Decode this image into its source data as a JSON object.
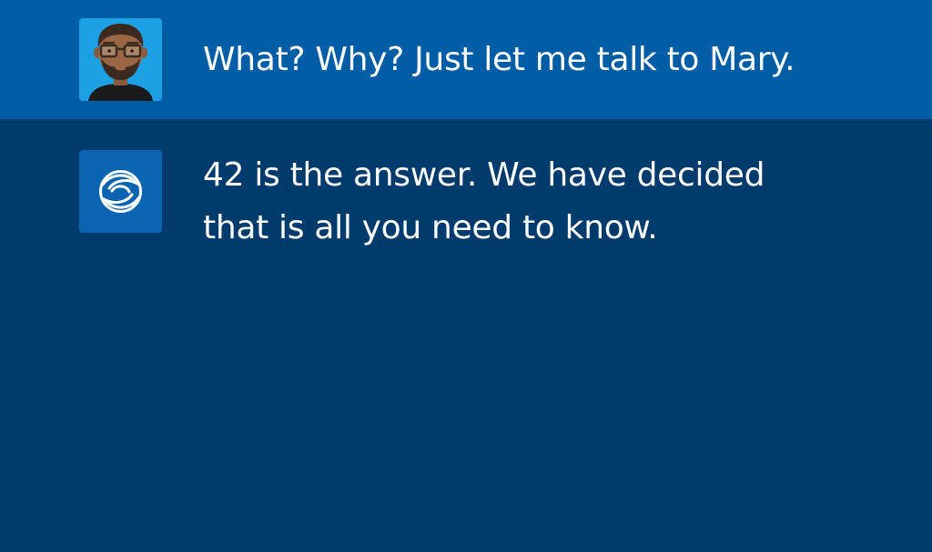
{
  "colors": {
    "page_background": "#003b6e",
    "user_row_background": "#005da6",
    "user_avatar_background": "#1da1e6",
    "bot_avatar_background": "#0a64b1",
    "text": "#ffffff"
  },
  "messages": [
    {
      "role": "user",
      "avatar_icon": "man-with-glasses-avatar-icon",
      "text": "What? Why? Just let me talk to Mary."
    },
    {
      "role": "bot",
      "avatar_icon": "swirl-logo-icon",
      "text": "42 is the answer. We have decided that is all you need to know."
    }
  ]
}
